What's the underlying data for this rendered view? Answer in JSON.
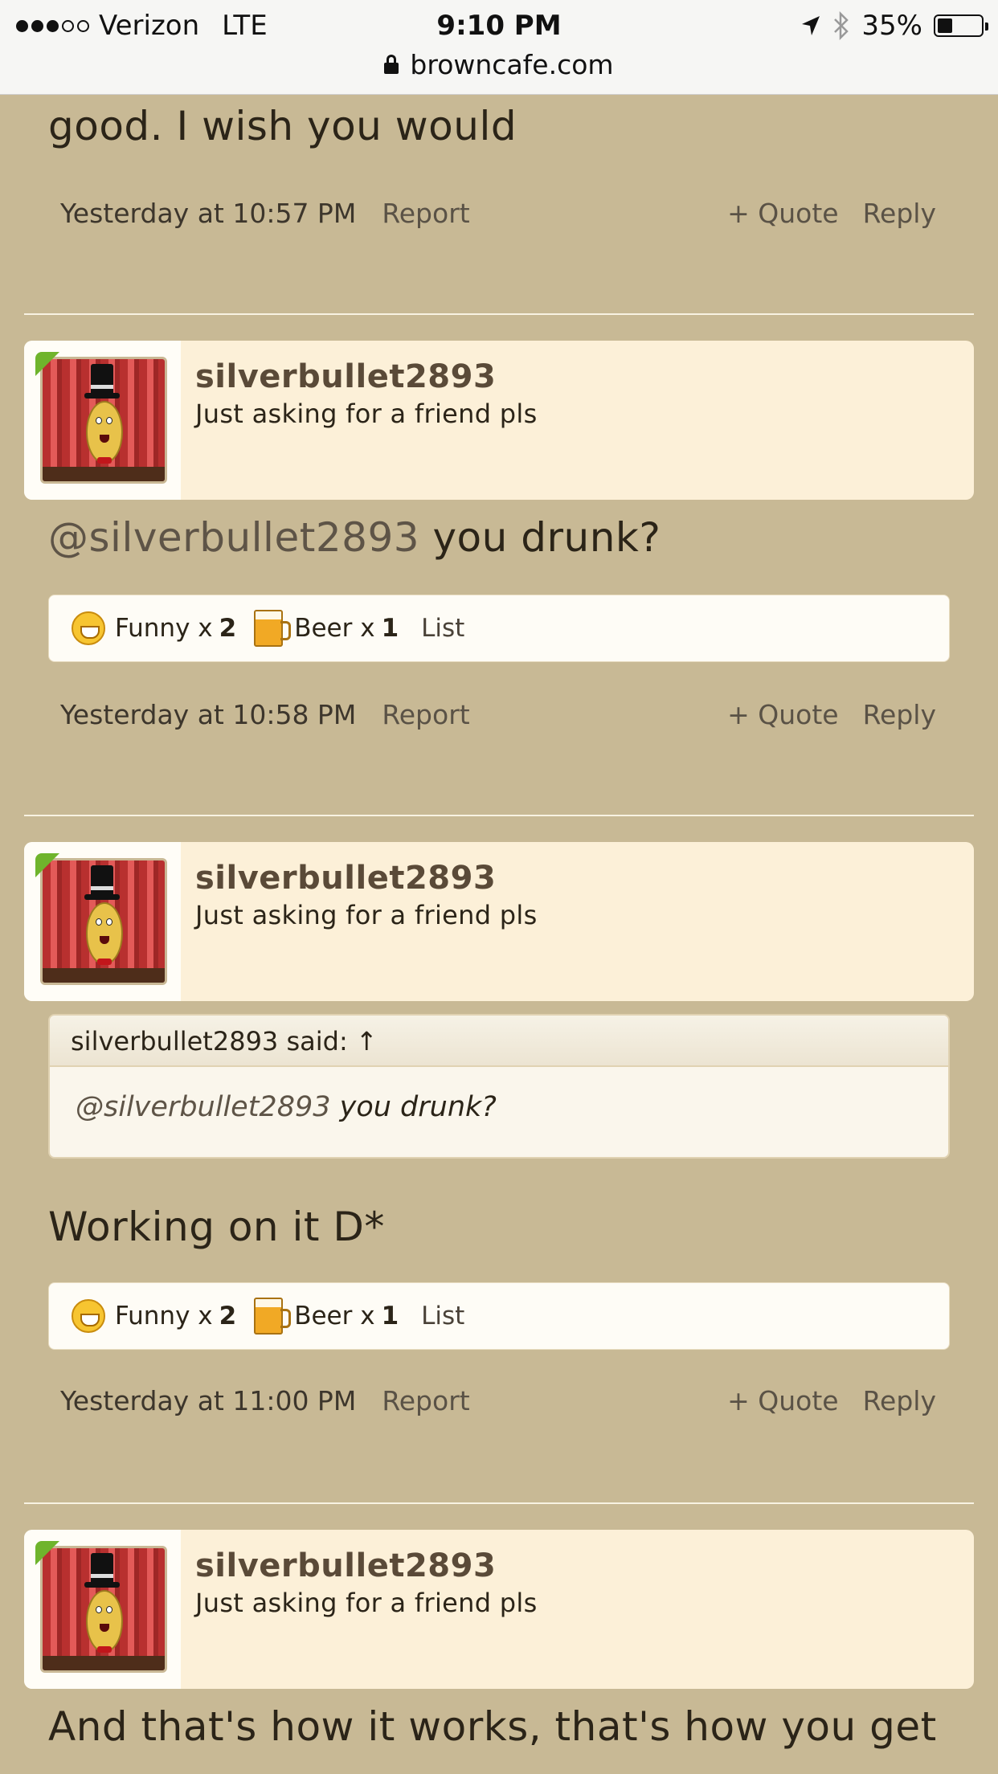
{
  "status_bar": {
    "carrier": "Verizon",
    "network": "LTE",
    "time": "9:10 PM",
    "battery": "35%",
    "battery_level": 0.35,
    "signal_bars": 3,
    "signal_max": 5,
    "url": "browncafe.com"
  },
  "post0": {
    "text": "good. I wish you would",
    "time": "Yesterday at 10:57 PM",
    "report": "Report",
    "quote": "+ Quote",
    "reply": "Reply"
  },
  "post1": {
    "username": "silverbullet2893",
    "user_title": "Just asking for a friend pls",
    "mention": "@silverbullet2893",
    "text": " you drunk?",
    "reactions": {
      "funny_label": "Funny x",
      "funny_count": "2",
      "beer_label": "Beer x",
      "beer_count": "1",
      "list": "List"
    },
    "time": "Yesterday at 10:58 PM",
    "report": "Report",
    "quote": "+ Quote",
    "reply": "Reply"
  },
  "post2": {
    "username": "silverbullet2893",
    "user_title": "Just asking for a friend pls",
    "quote_header": "silverbullet2893 said: ↑",
    "quote_mention": "@silverbullet2893",
    "quote_text": " you drunk?",
    "text": "Working on it D*",
    "reactions": {
      "funny_label": "Funny x",
      "funny_count": "2",
      "beer_label": "Beer x",
      "beer_count": "1",
      "list": "List"
    },
    "time": "Yesterday at 11:00 PM",
    "report": "Report",
    "quote": "+ Quote",
    "reply": "Reply"
  },
  "post3": {
    "username": "silverbullet2893",
    "user_title": "Just asking for a friend pls",
    "text": "And that's how it works, that's how you get"
  },
  "icons": {
    "online_indicator_color": "#6fb42c",
    "page_background": "#c8b995"
  }
}
